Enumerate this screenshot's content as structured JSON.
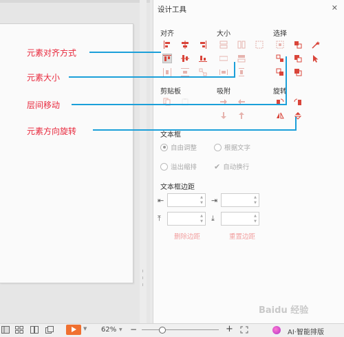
{
  "panel": {
    "title": "设计工具",
    "close": "✕",
    "sections": {
      "align": "对齐",
      "size": "大小",
      "select": "选择",
      "clipboard": "剪贴板",
      "snap": "吸附",
      "rotate": "旋转",
      "textbox": "文本框",
      "textbox_margin": "文本框边距"
    },
    "textbox_options": {
      "auto_adjust": "自由调整",
      "fit_text": "根据文字",
      "overflow_shrink": "溢出缩排",
      "auto_wrap": "自动换行"
    },
    "margin_icons": {
      "left": "⇤",
      "right": "⇥",
      "top": "⤒",
      "bottom": "⤓"
    },
    "margin_values": {
      "left": "",
      "right": "",
      "top": "",
      "bottom": ""
    },
    "delete_margin": "删除边距",
    "reset_margin": "重置边距"
  },
  "annotations": {
    "align_method": "元素对齐方式",
    "element_size": "元素大小",
    "layer_move": "层间移动",
    "rotate_direction": "元素方向旋转"
  },
  "statusbar": {
    "zoom": "62%",
    "zoom_minus": "−",
    "zoom_plus": "+",
    "ai_layout": "AI·智能排版"
  },
  "colors": {
    "icon_red": "#d9453a",
    "annotation_red": "#e8283c",
    "leader_blue": "#1a9fd9",
    "play_orange": "#f07030"
  },
  "watermark": "Baidu 经验"
}
